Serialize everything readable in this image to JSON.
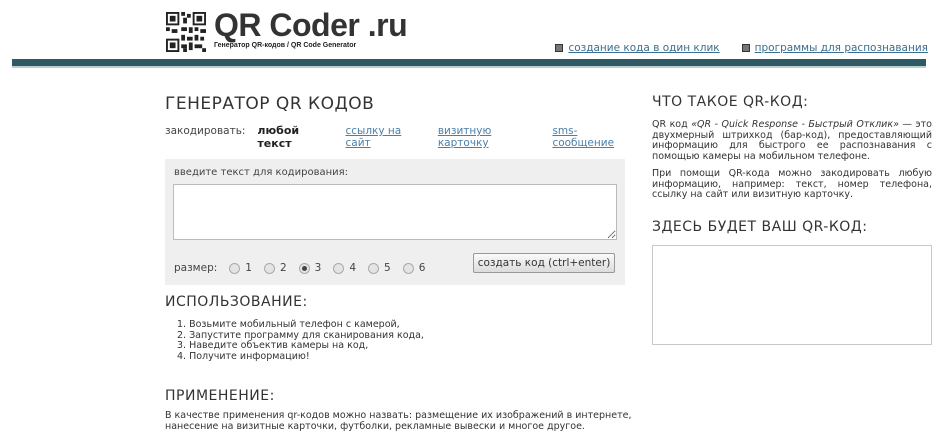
{
  "header": {
    "logo_title": "QR Coder .ru",
    "logo_subtitle": "Генератор QR-кодов / QR Code Generator",
    "links": [
      {
        "label": "создание кода в один клик"
      },
      {
        "label": "программы для распознавания"
      }
    ]
  },
  "generator": {
    "title": "ГЕНЕРАТОР QR КОДОВ",
    "encode_label": "закодировать:",
    "encode_options": [
      "любой текст",
      "ссылку на сайт",
      "визитную карточку",
      "sms-сообщение"
    ],
    "active_option": "любой текст",
    "input_label": "введите текст для кодирования:",
    "text_value": "",
    "size_label": "размер:",
    "sizes": [
      "1",
      "2",
      "3",
      "4",
      "5",
      "6"
    ],
    "selected_size": "3",
    "button_label": "создать код (ctrl+enter)"
  },
  "usage": {
    "title": "ИСПОЛЬЗОВАНИЕ:",
    "steps": [
      "1. Возьмите мобильный телефон с камерой,",
      "2. Запустите программу для сканирования кода,",
      "3. Наведите объектив камеры на код,",
      "4. Получите информацию!"
    ]
  },
  "application": {
    "title": "ПРИМЕНЕНИЕ:",
    "text": "В качестве применения qr-кодов можно назвать: размещение их изображений в интернете, нанесение на визитные карточки, футболки, рекламные вывески и многое другое."
  },
  "info": {
    "title": "ЧТО ТАКОЕ QR-КОД:",
    "p1_prefix": "QR код ",
    "p1_italic": "«QR - Quick Response - Быстрый Отклик»",
    "p1_rest": " — это двухмерный штрихкод (бар-код), предоставляющий информацию для быстрого ее распознавания с помощью камеры на мобильном телефоне.",
    "p2": "При помощи QR-кода можно закодировать любую информацию, например: текст, номер телефона, ссылку на сайт или визитную карточку.",
    "result_title": "ЗДЕСЬ БУДЕТ ВАШ QR-КОД:"
  }
}
